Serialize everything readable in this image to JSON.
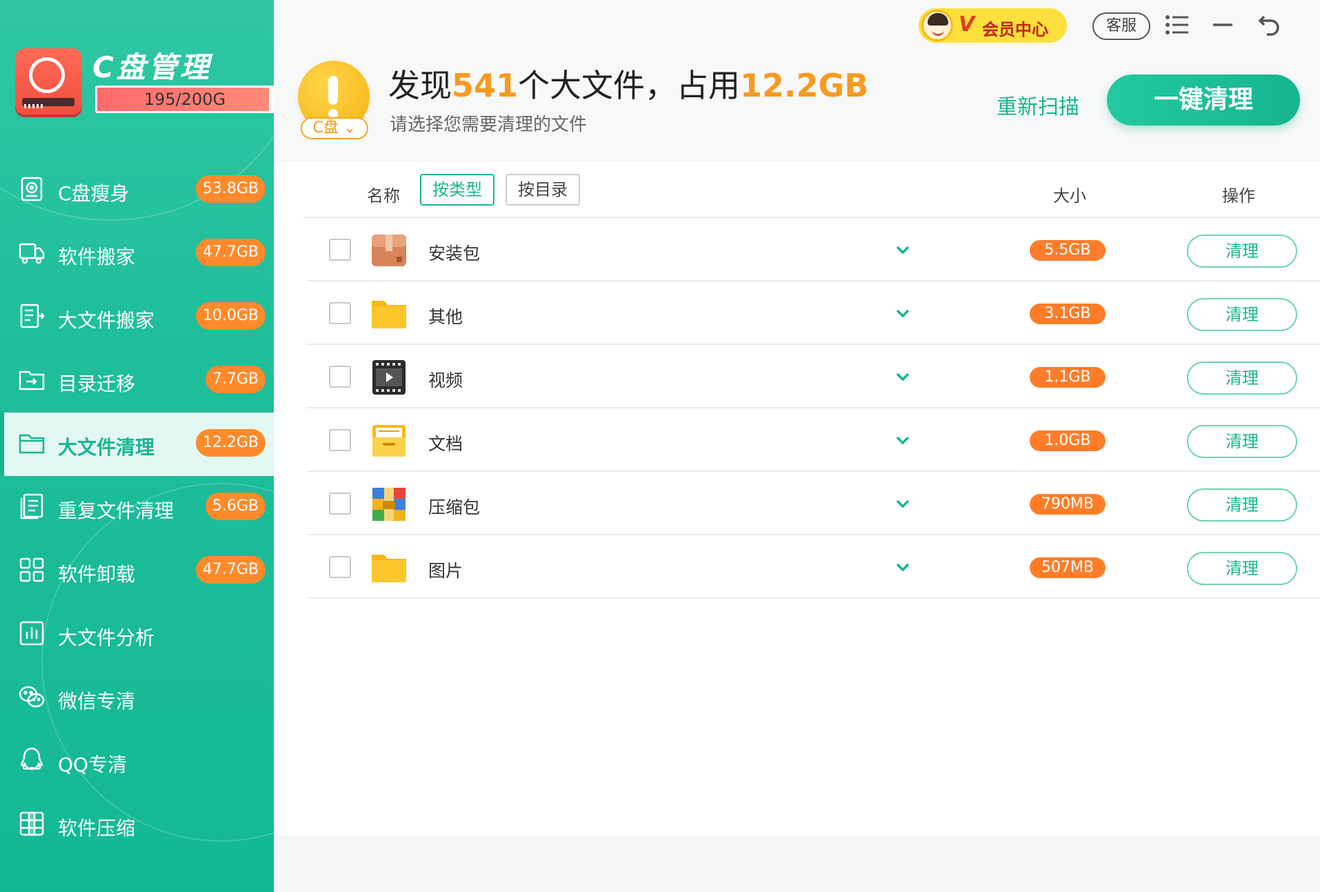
{
  "app": {
    "title": "C盘管理",
    "disk_usage_text": "195/200G",
    "disk_usage_fraction": 0.975
  },
  "sidebar": {
    "items": [
      {
        "label": "C盘瘦身",
        "badge": "53.8GB",
        "icon": "disk-slim-icon",
        "active": false
      },
      {
        "label": "软件搬家",
        "badge": "47.7GB",
        "icon": "truck-icon",
        "active": false
      },
      {
        "label": "大文件搬家",
        "badge": "10.0GB",
        "icon": "file-move-icon",
        "active": false
      },
      {
        "label": "目录迁移",
        "badge": "7.7GB",
        "icon": "folder-move-icon",
        "active": false
      },
      {
        "label": "大文件清理",
        "badge": "12.2GB",
        "icon": "folder-icon",
        "active": true
      },
      {
        "label": "重复文件清理",
        "badge": "5.6GB",
        "icon": "duplicate-file-icon",
        "active": false
      },
      {
        "label": "软件卸载",
        "badge": "47.7GB",
        "icon": "apps-grid-icon",
        "active": false
      },
      {
        "label": "大文件分析",
        "badge": "",
        "icon": "bar-chart-icon",
        "active": false
      },
      {
        "label": "微信专清",
        "badge": "",
        "icon": "wechat-icon",
        "active": false
      },
      {
        "label": "QQ专清",
        "badge": "",
        "icon": "qq-icon",
        "active": false
      },
      {
        "label": "软件压缩",
        "badge": "",
        "icon": "compress-icon",
        "active": false
      }
    ]
  },
  "topbar": {
    "vip_v": "V",
    "vip_label": "会员中心",
    "service_label": "客服"
  },
  "summary": {
    "prefix": "发现",
    "count": "541",
    "mid": "个大文件，占用",
    "total": "12.2GB",
    "subtitle": "请选择您需要清理的文件",
    "drive": "C盘",
    "rescan_label": "重新扫描",
    "clean_all_label": "一键清理"
  },
  "table": {
    "col_name": "名称",
    "tab_by_type": "按类型",
    "tab_by_dir": "按目录",
    "col_size": "大小",
    "col_action": "操作",
    "rows": [
      {
        "name": "安装包",
        "size": "5.5GB",
        "action": "清理",
        "icon": "package-box-icon"
      },
      {
        "name": "其他",
        "size": "3.1GB",
        "action": "清理",
        "icon": "folder-yellow-icon"
      },
      {
        "name": "视频",
        "size": "1.1GB",
        "action": "清理",
        "icon": "video-film-icon"
      },
      {
        "name": "文档",
        "size": "1.0GB",
        "action": "清理",
        "icon": "document-folder-icon"
      },
      {
        "name": "压缩包",
        "size": "790MB",
        "action": "清理",
        "icon": "archive-icon"
      },
      {
        "name": "图片",
        "size": "507MB",
        "action": "清理",
        "icon": "folder-yellow-icon"
      }
    ]
  },
  "colors": {
    "accent": "#17b690",
    "badge": "#ff8a2b",
    "highlight": "#f79a20"
  }
}
